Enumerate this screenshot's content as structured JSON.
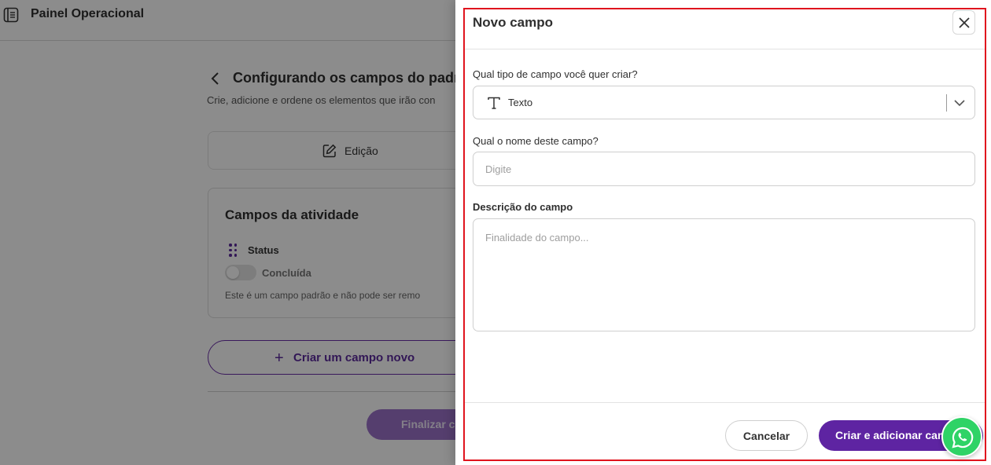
{
  "app": {
    "title": "Painel Operacional"
  },
  "page": {
    "heading": "Configurando os campos do padrã",
    "subtitle": "Crie, adicione e ordene os elementos que irão con",
    "edit_tab_label": "Edição",
    "card": {
      "title": "Campos da atividade",
      "field_name": "Status",
      "toggle_label": "Concluída",
      "note": "Este é um campo padrão e não pode ser remo"
    },
    "new_field_button": "Criar um campo novo",
    "finish_button": "Finalizar co"
  },
  "drawer": {
    "title": "Novo campo",
    "type_question": "Qual tipo de campo você quer criar?",
    "type_value": "Texto",
    "name_question": "Qual o nome deste campo?",
    "name_placeholder": "Digite",
    "description_label": "Descrição do campo",
    "description_placeholder": "Finalidade do campo...",
    "cancel_button": "Cancelar",
    "submit_button": "Criar e adicionar cam"
  },
  "colors": {
    "accent": "#5e24a2",
    "highlight_border": "#e0141e",
    "whatsapp": "#2fd366"
  },
  "icons": [
    "notebook-icon",
    "chevron-left-icon",
    "pencil-icon",
    "drag-handle-icon",
    "plus-icon",
    "close-icon",
    "text-type-icon",
    "chevron-down-icon",
    "whatsapp-icon"
  ]
}
